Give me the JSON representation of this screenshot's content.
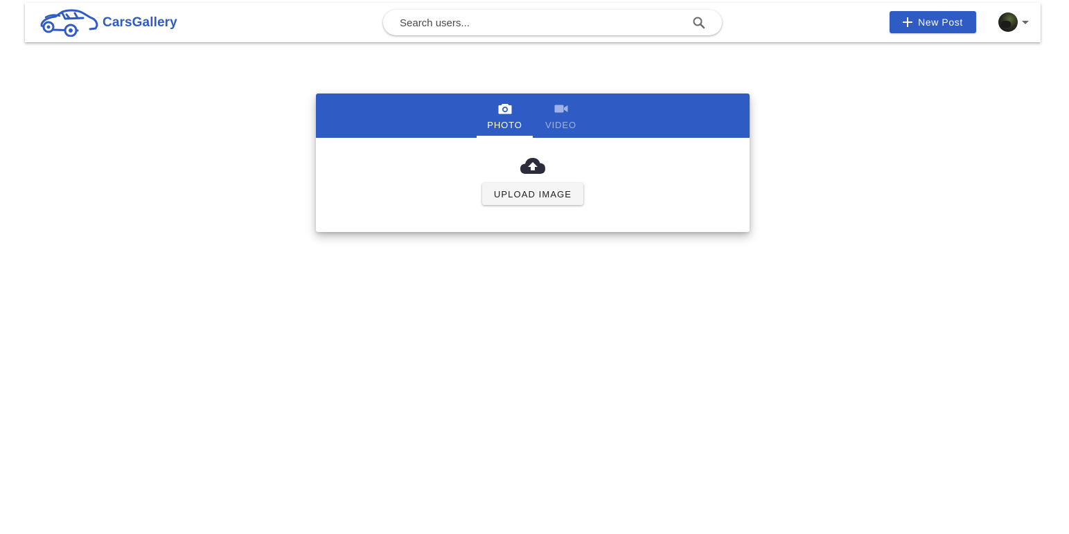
{
  "header": {
    "brand_name": "CarsGallery",
    "logo_icon": "car-icon",
    "search": {
      "placeholder": "Search users...",
      "icon": "search-icon"
    },
    "new_post_label": "New Post",
    "new_post_icon": "plus-icon",
    "account_menu_icon": "chevron-down-icon"
  },
  "upload_card": {
    "tabs": [
      {
        "label": "PHOTO",
        "icon": "camera-icon",
        "selected": true
      },
      {
        "label": "VIDEO",
        "icon": "video-camera-icon",
        "selected": false
      }
    ],
    "upload_icon": "cloud-upload-icon",
    "upload_button_label": "UPLOAD IMAGE"
  },
  "colors": {
    "brand": "#2f5bc4",
    "upload_icon": "#2b2d3c",
    "inactive_tab_text": "#9fb3e8"
  }
}
